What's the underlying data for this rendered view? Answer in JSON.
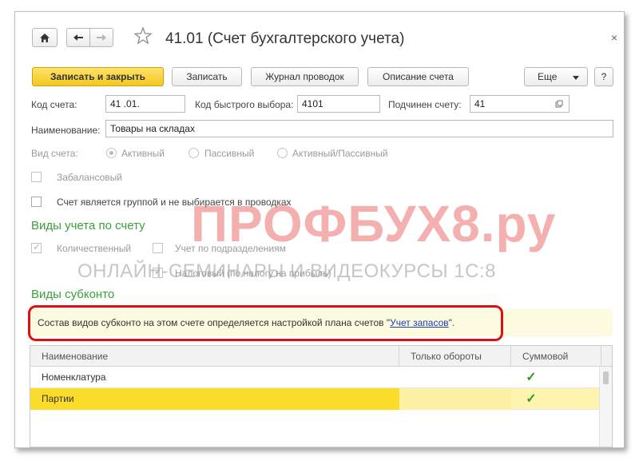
{
  "window": {
    "title": "41.01 (Счет бухгалтерского учета)",
    "close_glyph": "×"
  },
  "toolbar": {
    "save_close_label": "Записать и закрыть",
    "save_label": "Записать",
    "journal_label": "Журнал проводок",
    "description_label": "Описание счета",
    "more_label": "Еще",
    "help_label": "?"
  },
  "form": {
    "code_label": "Код счета:",
    "code_value": "41 .01.",
    "quick_code_label": "Код быстрого выбора:",
    "quick_code_value": "4101",
    "parent_label": "Подчинен счету:",
    "parent_value": "41",
    "name_label": "Наименование:",
    "name_value": "Товары на складах",
    "type_label": "Вид счета:",
    "type_options": [
      "Активный",
      "Пассивный",
      "Активный/Пассивный"
    ],
    "type_selected": "Активный",
    "offbalance_label": "Забалансовый",
    "group_label": "Счет является группой и не выбирается в проводках"
  },
  "accounting_kinds": {
    "title": "Виды учета по счету",
    "quantitative_label": "Количественный",
    "quantitative_checked": true,
    "by_division_label": "Учет по подразделениям",
    "tax_label": "Налоговый (по налогу на прибыль)",
    "tax_checked": true
  },
  "watermark": {
    "brand": "ПРОФБУХ8.ру",
    "subtitle": "ОНЛАЙН-СЕМИНАРЫ И ВИДЕОКУРСЫ 1С:8"
  },
  "subconto": {
    "title": "Виды субконто",
    "info_text": "Состав видов субконто на этом счете определяется настройкой плана счетов \"",
    "info_link": "Учет запасов",
    "info_tail": "\".",
    "columns": [
      "Наименование",
      "Только обороты",
      "Суммовой"
    ],
    "rows": [
      {
        "name": "Номенклатура",
        "turnover_only": "",
        "sum": "✓"
      },
      {
        "name": "Партии",
        "turnover_only": "",
        "sum": "✓"
      }
    ]
  },
  "colors": {
    "accent_green": "#3aa13a",
    "primary_button": "#f3c81f",
    "highlight_frame": "#e00f0f",
    "selected_row": "#fcdc2b"
  },
  "icons": {
    "home": "home-icon",
    "back": "arrow-left-icon",
    "forward": "arrow-right-icon",
    "favorite": "star-icon",
    "dropdown": "chevron-down-icon",
    "open": "open-link-icon"
  }
}
